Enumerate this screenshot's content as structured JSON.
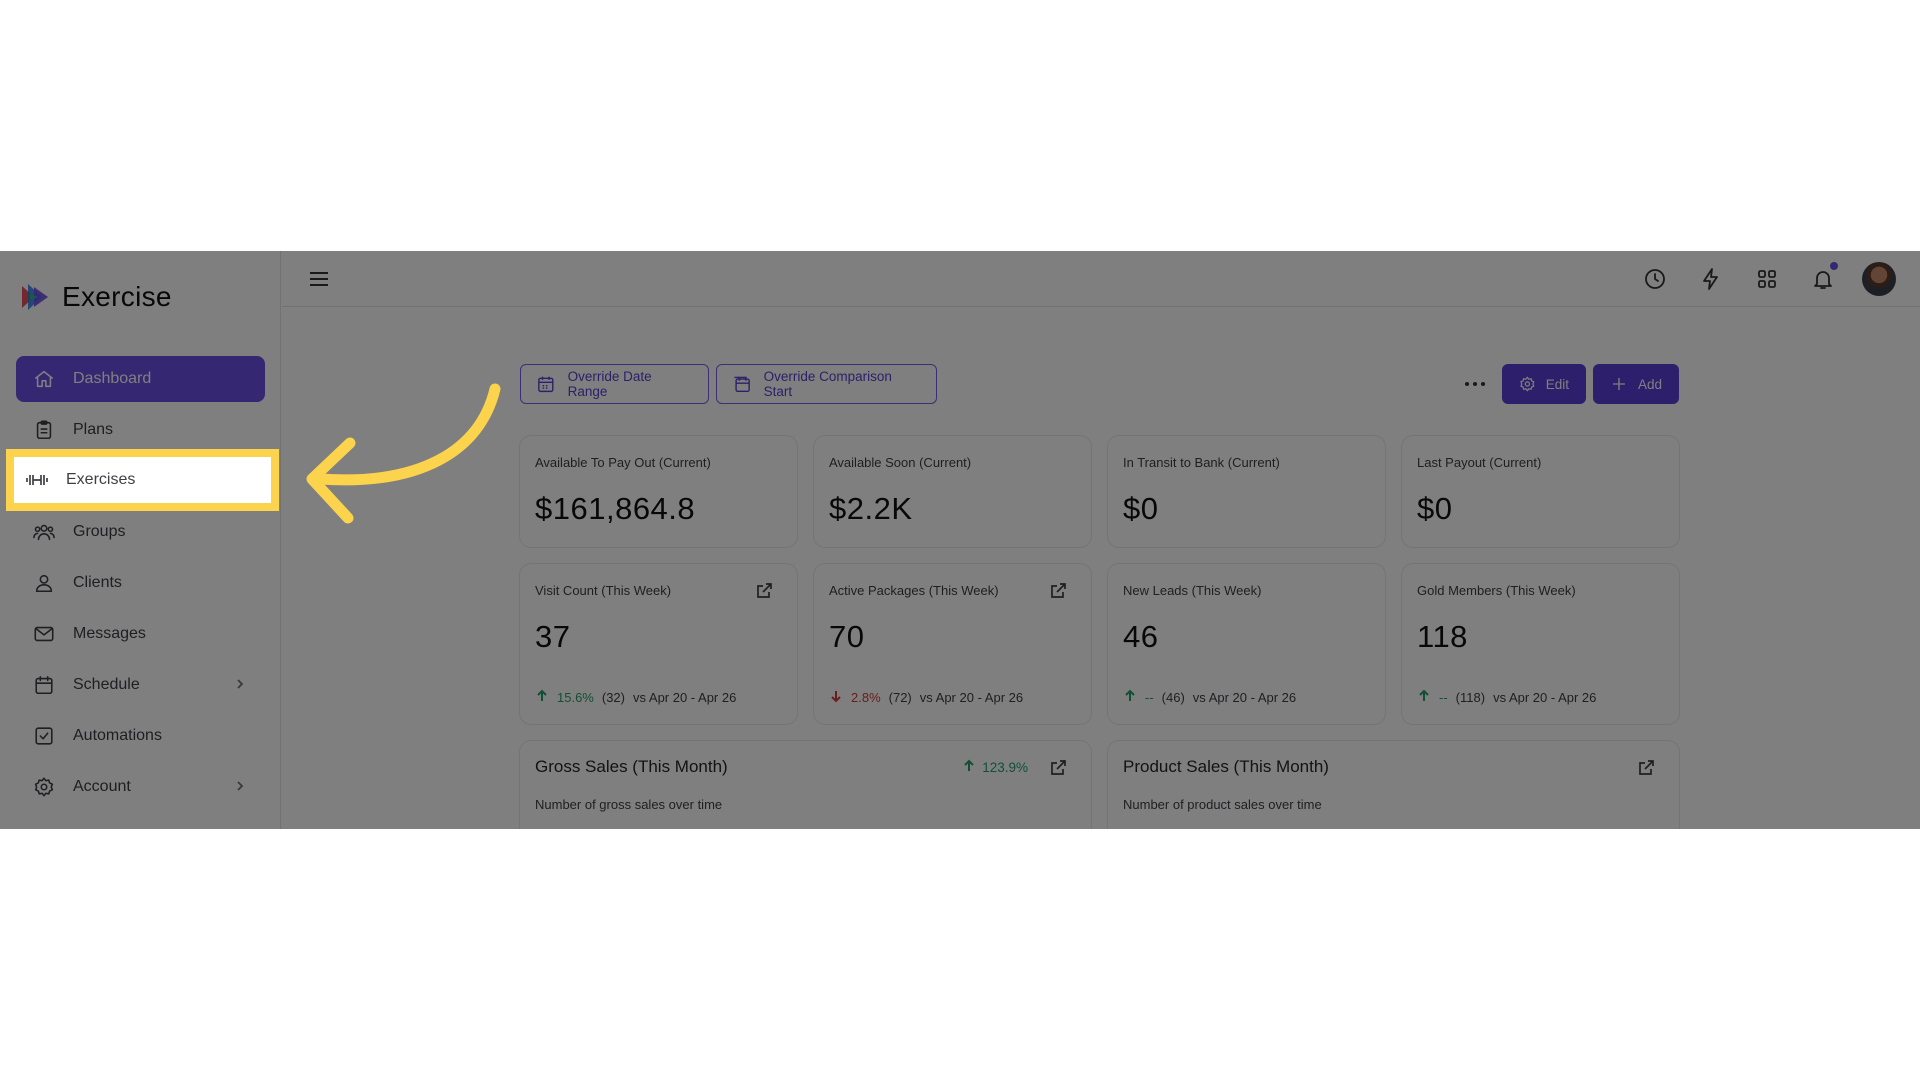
{
  "app": {
    "name": "Exercise"
  },
  "sidebar": {
    "items": [
      {
        "label": "Dashboard",
        "icon": "home-icon"
      },
      {
        "label": "Plans",
        "icon": "clipboard-icon"
      },
      {
        "label": "Exercises",
        "icon": "dumbbell-icon"
      },
      {
        "label": "Groups",
        "icon": "users-icon"
      },
      {
        "label": "Clients",
        "icon": "user-icon"
      },
      {
        "label": "Messages",
        "icon": "mail-icon"
      },
      {
        "label": "Schedule",
        "icon": "calendar-icon"
      },
      {
        "label": "Automations",
        "icon": "check-square-icon"
      },
      {
        "label": "Account",
        "icon": "gear-icon"
      }
    ]
  },
  "toolbar": {
    "override_date_range": "Override Date Range",
    "override_comparison_start": "Override Comparison Start",
    "edit": "Edit",
    "add": "Add"
  },
  "stats_top": [
    {
      "label": "Available To Pay Out (Current)",
      "value": "$161,864.8"
    },
    {
      "label": "Available Soon (Current)",
      "value": "$2.2K"
    },
    {
      "label": "In Transit to Bank (Current)",
      "value": "$0"
    },
    {
      "label": "Last Payout (Current)",
      "value": "$0"
    }
  ],
  "stats_week": [
    {
      "label": "Visit Count (This Week)",
      "value": "37",
      "change": "15.6%",
      "direction": "up",
      "prev": "(32)",
      "range": "vs Apr 20 - Apr 26"
    },
    {
      "label": "Active Packages (This Week)",
      "value": "70",
      "change": "2.8%",
      "direction": "down",
      "prev": "(72)",
      "range": "vs Apr 20 - Apr 26"
    },
    {
      "label": "New Leads (This Week)",
      "value": "46",
      "change": "--",
      "direction": "up",
      "prev": "(46)",
      "range": "vs Apr 20 - Apr 26"
    },
    {
      "label": "Gold Members (This Week)",
      "value": "118",
      "change": "--",
      "direction": "up",
      "prev": "(118)",
      "range": "vs Apr 20 - Apr 26"
    }
  ],
  "charts": [
    {
      "title": "Gross Sales (This Month)",
      "subtitle": "Number of gross sales over time",
      "change": "123.9%"
    },
    {
      "title": "Product Sales (This Month)",
      "subtitle": "Number of product sales over time"
    }
  ],
  "colors": {
    "accent": "#6d4ee6",
    "highlight": "#fcd34d",
    "positive": "#22a06b",
    "negative": "#d33a3a"
  }
}
